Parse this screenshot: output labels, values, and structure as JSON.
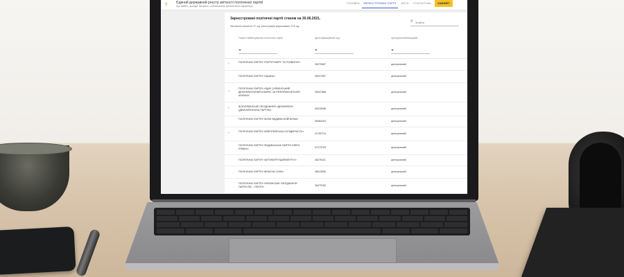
{
  "site": {
    "title": "Єдиний державний реєстр звітності політичних партій",
    "subtitle": "про майно, доходи, витрати і зобов'язання фінансового характеру",
    "nav": [
      "ГОЛОВНА",
      "ЗАРЕЄСТРОВАНІ ПАРТІЇ",
      "ЗВІТИ",
      "СТАТИСТИКА"
    ],
    "active_nav": "ЗАРЕЄСТРОВАНІ ПАРТІЇ",
    "cabinet_label": "КАБІНЕТ",
    "accent_color": "#3d58c4",
    "cabinet_color": "#f3c229"
  },
  "card": {
    "title": "Зареєстровані політичні партії станом на 30.06.2021.",
    "subtitle": "Загальна кількість 27 од, реєстрацію анульовано 276 од.",
    "search_placeholder": "Знайти",
    "columns": [
      "Повне найменування політичної партії",
      "Ідентифікаційний код",
      "Центральний/місцевий"
    ]
  },
  "rows": [
    {
      "expandable": true,
      "name": "ПОЛІТИЧНА ПАРТІЯ «ПАРТІЯ МИРУ ТА РОЗВИТКУ»",
      "code": "39279087",
      "type": "центральний"
    },
    {
      "expandable": false,
      "name": "ПОЛІТИЧНА ПАРТІЯ «Україна»",
      "code": "40917067",
      "type": "центральний"
    },
    {
      "expandable": true,
      "name": "ПОЛІТИЧНА ПАРТІЯ «УДАР (УКРАЇНСЬКИЙ ДЕМОКРАТИЧНИЙ АЛЬЯНС ЗА РЕФОРМИ) ВІТАЛІЯ КЛИЧКА»",
      "code": "33347568",
      "type": "центральний"
    },
    {
      "expandable": true,
      "name": "ВСЕУКРАЇНСЬКЕ ОБ'ЄДНАННЯ «ДЕМОКРАТИ (ДЕМОКРАТИЧНА ПАРТІЯ)»",
      "code": "00015285",
      "type": "центральний"
    },
    {
      "expandable": false,
      "name": "ПОЛІТИЧНА ПАРТІЯ «БЛОК ВАДИМА БОЙЧЕНКА»",
      "code": "39464116",
      "type": "центральний"
    },
    {
      "expandable": true,
      "name": "ПОЛІТИЧНА ПАРТІЯ «ЄВРОПЕЙСЬКА СОЛІДАРНІСТЬ»",
      "code": "21752714",
      "type": "центральний"
    },
    {
      "expandable": false,
      "name": "ПОЛІТИЧНА ПАРТІЯ «РАДИКАЛЬНА ПАРТІЯ ОЛЕГА ЛЯШКА»",
      "code": "37279703",
      "type": "центральний"
    },
    {
      "expandable": false,
      "name": "ПОЛІТИЧНА ПАРТІЯ «АНТИКОРУПЦІЙНИЙ РУХ»",
      "code": "40276311",
      "type": "центральний"
    },
    {
      "expandable": false,
      "name": "ПОЛІТИЧНА ПАРТІЯ «ВЛАСНА СИЛА»",
      "code": "38013535",
      "type": "центральний"
    },
    {
      "expandable": false,
      "name": "ПОЛІТИЧНА ПАРТІЯ «УКРАЇНСЬКЕ ОБ'ЄДНАННЯ ПАТРІОТІВ – УКРОП»",
      "code": "39479782",
      "type": "центральний"
    }
  ]
}
